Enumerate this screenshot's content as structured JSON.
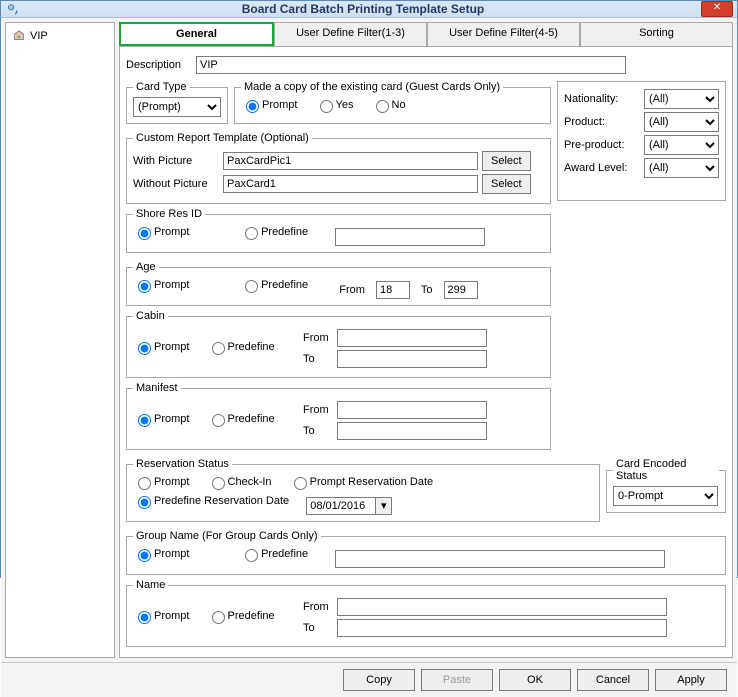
{
  "window": {
    "title": "Board Card Batch Printing Template Setup"
  },
  "sidebar": {
    "items": [
      {
        "label": "VIP"
      }
    ]
  },
  "tabs": [
    {
      "label": "General"
    },
    {
      "label": "User Define Filter(1-3)"
    },
    {
      "label": "User Define Filter(4-5)"
    },
    {
      "label": "Sorting"
    }
  ],
  "desc": {
    "label": "Description",
    "value": "VIP"
  },
  "card_type": {
    "legend": "Card Type",
    "value": "(Prompt)"
  },
  "copy_card": {
    "legend": "Made a copy of the existing card (Guest Cards Only)",
    "prompt": "Prompt",
    "yes": "Yes",
    "no": "No"
  },
  "custom_report": {
    "legend": "Custom Report Template (Optional)",
    "with_pic_label": "With Picture",
    "with_pic_value": "PaxCardPic1",
    "without_pic_label": "Without Picture",
    "without_pic_value": "PaxCard1",
    "select": "Select"
  },
  "filters": {
    "nationality": {
      "label": "Nationality:",
      "value": "(All)"
    },
    "product": {
      "label": "Product:",
      "value": "(All)"
    },
    "preproduct": {
      "label": "Pre-product:",
      "value": "(All)"
    },
    "award": {
      "label": "Award Level:",
      "value": "(All)"
    }
  },
  "shore": {
    "legend": "Shore Res ID",
    "prompt": "Prompt",
    "predefine": "Predefine",
    "value": ""
  },
  "age": {
    "legend": "Age",
    "prompt": "Prompt",
    "predefine": "Predefine",
    "from_label": "From",
    "from": "18",
    "to_label": "To",
    "to": "299"
  },
  "cabin": {
    "legend": "Cabin",
    "prompt": "Prompt",
    "predefine": "Predefine",
    "from_label": "From",
    "to_label": "To"
  },
  "manifest": {
    "legend": "Manifest",
    "prompt": "Prompt",
    "predefine": "Predefine",
    "from_label": "From",
    "to_label": "To"
  },
  "reservation": {
    "legend": "Reservation Status",
    "prompt": "Prompt",
    "checkin": "Check-In",
    "prompt_date": "Prompt Reservation Date",
    "predefine_date": "Predefine Reservation Date",
    "date": "08/01/2016"
  },
  "card_encoded": {
    "legend": "Card Encoded Status",
    "value": "0-Prompt"
  },
  "group": {
    "legend": "Group Name (For Group Cards Only)",
    "prompt": "Prompt",
    "predefine": "Predefine"
  },
  "name": {
    "legend": "Name",
    "prompt": "Prompt",
    "predefine": "Predefine",
    "from_label": "From",
    "to_label": "To"
  },
  "footer": {
    "copy": "Copy",
    "paste": "Paste",
    "ok": "OK",
    "cancel": "Cancel",
    "apply": "Apply"
  }
}
